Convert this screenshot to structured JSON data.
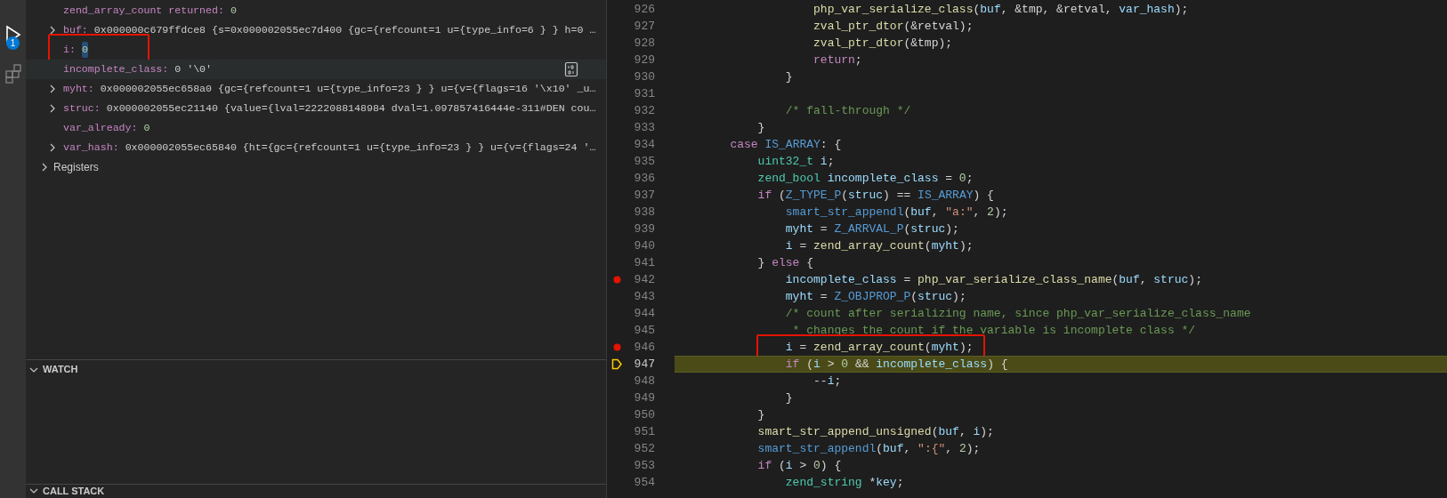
{
  "activity_bar": {
    "items": [
      {
        "kind": "debug",
        "selected": true,
        "badge": "1"
      },
      {
        "kind": "extensions",
        "selected": false
      }
    ]
  },
  "variables": {
    "items": [
      {
        "name": "zend_array_count returned:",
        "value": "0",
        "kind": "number",
        "selected": false,
        "value_focused": false,
        "annotated": false
      },
      {
        "name": "buf:",
        "value": "0x000000c679ffdce8 {s=0x000002055ec7d400 {gc={refcount=1 u={type_info=6 } } h=0 …",
        "kind": "object",
        "expanded": false,
        "selected": false,
        "value_focused": false,
        "annotated": false
      },
      {
        "name": "i:",
        "value": "0",
        "kind": "number",
        "selected": false,
        "value_focused": true,
        "annotated": true
      },
      {
        "name": "incomplete_class:",
        "value": "0 '\\0'",
        "kind": "char",
        "selected": true,
        "value_focused": false,
        "annotated": false
      },
      {
        "name": "myht:",
        "value": "0x000002055ec658a0 {gc={refcount=1 u={type_info=23 } } u={v={flags=16 '\\x10' _u…",
        "kind": "object",
        "expanded": false,
        "selected": false,
        "value_focused": false,
        "annotated": false
      },
      {
        "name": "struc:",
        "value": "0x000002055ec21140 {value={lval=2222088148984 dval=1.097857416444e-311#DEN cou…",
        "kind": "object",
        "expanded": false,
        "selected": false,
        "value_focused": false,
        "annotated": false
      },
      {
        "name": "var_already:",
        "value": "0",
        "kind": "number",
        "selected": false,
        "value_focused": false,
        "annotated": false
      },
      {
        "name": "var_hash:",
        "value": "0x000002055ec65840 {ht={gc={refcount=1 u={type_info=23 } } u={v={flags=24 '…",
        "kind": "object",
        "expanded": false,
        "selected": false,
        "value_focused": false,
        "annotated": false
      }
    ],
    "scopes": [
      {
        "label": "Registers",
        "expanded": false
      }
    ]
  },
  "sections": [
    {
      "title": "WATCH",
      "expanded": true
    },
    {
      "title": "CALL STACK",
      "expanded": true
    }
  ],
  "editor": {
    "lines": [
      {
        "number": "926",
        "breakpoint": false,
        "current": false,
        "annotated": false,
        "tokens": [
          {
            "kind": "f",
            "text": "                    php_var_serialize_class"
          },
          {
            "kind": "p",
            "text": "("
          },
          {
            "kind": "v",
            "text": "buf"
          },
          {
            "kind": "p",
            "text": ", &tmp, &retval, "
          },
          {
            "kind": "v",
            "text": "var_hash"
          },
          {
            "kind": "p",
            "text": ");"
          }
        ]
      },
      {
        "number": "927",
        "breakpoint": false,
        "current": false,
        "annotated": false,
        "tokens": [
          {
            "kind": "f",
            "text": "                    zval_ptr_dtor"
          },
          {
            "kind": "p",
            "text": "(&retval);"
          }
        ]
      },
      {
        "number": "928",
        "breakpoint": false,
        "current": false,
        "annotated": false,
        "tokens": [
          {
            "kind": "f",
            "text": "                    zval_ptr_dtor"
          },
          {
            "kind": "p",
            "text": "(&tmp);"
          }
        ]
      },
      {
        "number": "929",
        "breakpoint": false,
        "current": false,
        "annotated": false,
        "tokens": [
          {
            "kind": "k",
            "text": "                    return"
          },
          {
            "kind": "p",
            "text": ";"
          }
        ]
      },
      {
        "number": "930",
        "breakpoint": false,
        "current": false,
        "annotated": false,
        "tokens": [
          {
            "kind": "p",
            "text": "                }"
          }
        ]
      },
      {
        "number": "931",
        "breakpoint": false,
        "current": false,
        "annotated": false
      },
      {
        "number": "932",
        "breakpoint": false,
        "current": false,
        "annotated": false,
        "tokens": [
          {
            "kind": "c",
            "text": "                /* fall-through */"
          }
        ]
      },
      {
        "number": "933",
        "breakpoint": false,
        "current": false,
        "annotated": false,
        "tokens": [
          {
            "kind": "p",
            "text": "            }"
          }
        ]
      },
      {
        "number": "934",
        "breakpoint": false,
        "current": false,
        "annotated": false,
        "tokens": [
          {
            "kind": "k",
            "text": "        case"
          },
          {
            "kind": "m",
            "text": " IS_ARRAY"
          },
          {
            "kind": "p",
            "text": ": {"
          }
        ]
      },
      {
        "number": "935",
        "breakpoint": false,
        "current": false,
        "annotated": false,
        "tokens": [
          {
            "kind": "t",
            "text": "            uint32_t"
          },
          {
            "kind": "v",
            "text": " i"
          },
          {
            "kind": "p",
            "text": ";"
          }
        ]
      },
      {
        "number": "936",
        "breakpoint": false,
        "current": false,
        "annotated": false,
        "tokens": [
          {
            "kind": "t",
            "text": "            zend_bool"
          },
          {
            "kind": "v",
            "text": " incomplete_class"
          },
          {
            "kind": "p",
            "text": " = "
          },
          {
            "kind": "n",
            "text": "0"
          },
          {
            "kind": "p",
            "text": ";"
          }
        ]
      },
      {
        "number": "937",
        "breakpoint": false,
        "current": false,
        "annotated": false,
        "tokens": [
          {
            "kind": "k",
            "text": "            if"
          },
          {
            "kind": "p",
            "text": " ("
          },
          {
            "kind": "m",
            "text": "Z_TYPE_P"
          },
          {
            "kind": "p",
            "text": "("
          },
          {
            "kind": "v",
            "text": "struc"
          },
          {
            "kind": "p",
            "text": ") == "
          },
          {
            "kind": "m",
            "text": "IS_ARRAY"
          },
          {
            "kind": "p",
            "text": ") {"
          }
        ]
      },
      {
        "number": "938",
        "breakpoint": false,
        "current": false,
        "annotated": false,
        "tokens": [
          {
            "kind": "m",
            "text": "                smart_str_appendl"
          },
          {
            "kind": "p",
            "text": "("
          },
          {
            "kind": "v",
            "text": "buf"
          },
          {
            "kind": "p",
            "text": ", "
          },
          {
            "kind": "s",
            "text": "\"a:\""
          },
          {
            "kind": "p",
            "text": ", "
          },
          {
            "kind": "n",
            "text": "2"
          },
          {
            "kind": "p",
            "text": ");"
          }
        ]
      },
      {
        "number": "939",
        "breakpoint": false,
        "current": false,
        "annotated": false,
        "tokens": [
          {
            "kind": "v",
            "text": "                myht"
          },
          {
            "kind": "p",
            "text": " = "
          },
          {
            "kind": "m",
            "text": "Z_ARRVAL_P"
          },
          {
            "kind": "p",
            "text": "("
          },
          {
            "kind": "v",
            "text": "struc"
          },
          {
            "kind": "p",
            "text": ");"
          }
        ]
      },
      {
        "number": "940",
        "breakpoint": false,
        "current": false,
        "annotated": false,
        "tokens": [
          {
            "kind": "v",
            "text": "                i"
          },
          {
            "kind": "p",
            "text": " = "
          },
          {
            "kind": "f",
            "text": "zend_array_count"
          },
          {
            "kind": "p",
            "text": "("
          },
          {
            "kind": "v",
            "text": "myht"
          },
          {
            "kind": "p",
            "text": ");"
          }
        ]
      },
      {
        "number": "941",
        "breakpoint": false,
        "current": false,
        "annotated": false,
        "tokens": [
          {
            "kind": "p",
            "text": "            } "
          },
          {
            "kind": "k",
            "text": "else"
          },
          {
            "kind": "p",
            "text": " {"
          }
        ]
      },
      {
        "number": "942",
        "breakpoint": true,
        "current": false,
        "annotated": false,
        "tokens": [
          {
            "kind": "v",
            "text": "                incomplete_class"
          },
          {
            "kind": "p",
            "text": " = "
          },
          {
            "kind": "f",
            "text": "php_var_serialize_class_name"
          },
          {
            "kind": "p",
            "text": "("
          },
          {
            "kind": "v",
            "text": "buf"
          },
          {
            "kind": "p",
            "text": ", "
          },
          {
            "kind": "v",
            "text": "struc"
          },
          {
            "kind": "p",
            "text": ");"
          }
        ]
      },
      {
        "number": "943",
        "breakpoint": false,
        "current": false,
        "annotated": false,
        "tokens": [
          {
            "kind": "v",
            "text": "                myht"
          },
          {
            "kind": "p",
            "text": " = "
          },
          {
            "kind": "m",
            "text": "Z_OBJPROP_P"
          },
          {
            "kind": "p",
            "text": "("
          },
          {
            "kind": "v",
            "text": "struc"
          },
          {
            "kind": "p",
            "text": ");"
          }
        ]
      },
      {
        "number": "944",
        "breakpoint": false,
        "current": false,
        "annotated": false,
        "tokens": [
          {
            "kind": "c",
            "text": "                /* count after serializing name, since php_var_serialize_class_name"
          }
        ]
      },
      {
        "number": "945",
        "breakpoint": false,
        "current": false,
        "annotated": false,
        "tokens": [
          {
            "kind": "c",
            "text": "                 * changes the count if the variable is incomplete class */"
          }
        ]
      },
      {
        "number": "946",
        "breakpoint": true,
        "current": false,
        "annotated": true,
        "tokens": [
          {
            "kind": "v",
            "text": "                i"
          },
          {
            "kind": "p",
            "text": " = "
          },
          {
            "kind": "f",
            "text": "zend_array_count"
          },
          {
            "kind": "p",
            "text": "("
          },
          {
            "kind": "v",
            "text": "myht"
          },
          {
            "kind": "p",
            "text": ");"
          }
        ]
      },
      {
        "number": "947",
        "breakpoint": false,
        "current": true,
        "annotated": false,
        "tokens": [
          {
            "kind": "k",
            "text": "                if"
          },
          {
            "kind": "p",
            "text": " ("
          },
          {
            "kind": "v",
            "text": "i"
          },
          {
            "kind": "p",
            "text": " > "
          },
          {
            "kind": "n",
            "text": "0"
          },
          {
            "kind": "p",
            "text": " && "
          },
          {
            "kind": "v",
            "text": "incomplete_class"
          },
          {
            "kind": "p",
            "text": ") {"
          }
        ]
      },
      {
        "number": "948",
        "breakpoint": false,
        "current": false,
        "annotated": false,
        "tokens": [
          {
            "kind": "p",
            "text": "                    --"
          },
          {
            "kind": "v",
            "text": "i"
          },
          {
            "kind": "p",
            "text": ";"
          }
        ]
      },
      {
        "number": "949",
        "breakpoint": false,
        "current": false,
        "annotated": false,
        "tokens": [
          {
            "kind": "p",
            "text": "                }"
          }
        ]
      },
      {
        "number": "950",
        "breakpoint": false,
        "current": false,
        "annotated": false,
        "tokens": [
          {
            "kind": "p",
            "text": "            }"
          }
        ]
      },
      {
        "number": "951",
        "breakpoint": false,
        "current": false,
        "annotated": false,
        "tokens": [
          {
            "kind": "f",
            "text": "            smart_str_append_unsigned"
          },
          {
            "kind": "p",
            "text": "("
          },
          {
            "kind": "v",
            "text": "buf"
          },
          {
            "kind": "p",
            "text": ", "
          },
          {
            "kind": "v",
            "text": "i"
          },
          {
            "kind": "p",
            "text": ");"
          }
        ]
      },
      {
        "number": "952",
        "breakpoint": false,
        "current": false,
        "annotated": false,
        "tokens": [
          {
            "kind": "m",
            "text": "            smart_str_appendl"
          },
          {
            "kind": "p",
            "text": "("
          },
          {
            "kind": "v",
            "text": "buf"
          },
          {
            "kind": "p",
            "text": ", "
          },
          {
            "kind": "s",
            "text": "\":{\""
          },
          {
            "kind": "p",
            "text": ", "
          },
          {
            "kind": "n",
            "text": "2"
          },
          {
            "kind": "p",
            "text": ");"
          }
        ]
      },
      {
        "number": "953",
        "breakpoint": false,
        "current": false,
        "annotated": false,
        "tokens": [
          {
            "kind": "k",
            "text": "            if"
          },
          {
            "kind": "p",
            "text": " ("
          },
          {
            "kind": "v",
            "text": "i"
          },
          {
            "kind": "p",
            "text": " > "
          },
          {
            "kind": "n",
            "text": "0"
          },
          {
            "kind": "p",
            "text": ") {"
          }
        ]
      },
      {
        "number": "954",
        "breakpoint": false,
        "current": false,
        "annotated": false,
        "tokens": [
          {
            "kind": "t",
            "text": "                zend_string"
          },
          {
            "kind": "p",
            "text": " *"
          },
          {
            "kind": "v",
            "text": "key"
          },
          {
            "kind": "p",
            "text": ";"
          }
        ]
      }
    ]
  }
}
